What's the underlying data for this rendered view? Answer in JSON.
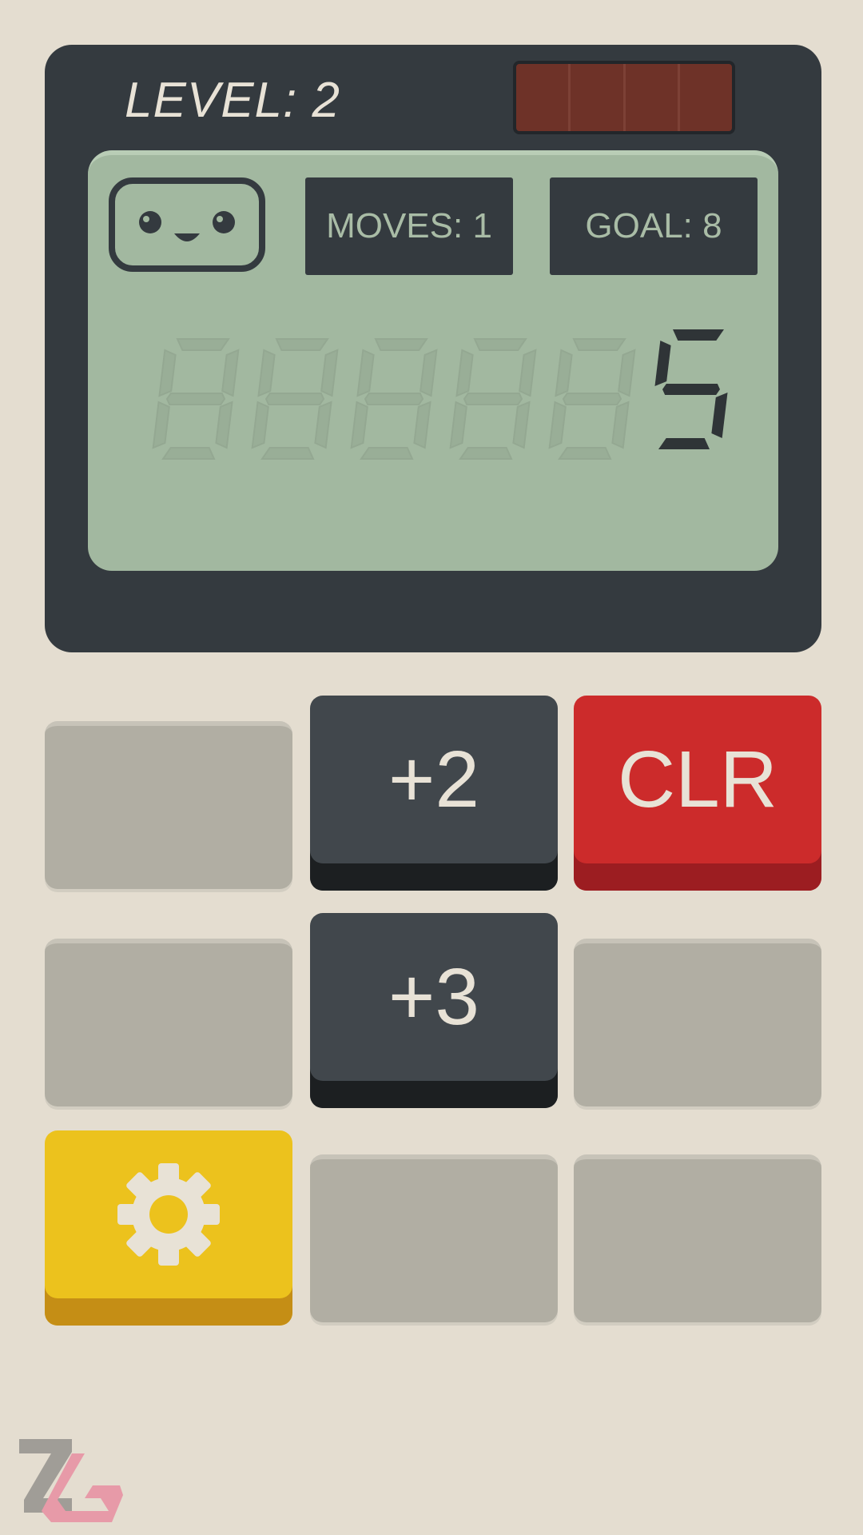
{
  "header": {
    "level_label": "LEVEL: 2"
  },
  "display": {
    "moves_label": "MOVES: 1",
    "goal_label": "GOAL: 8",
    "value": "5"
  },
  "buttons": {
    "add2_label": "+2",
    "add3_label": "+3",
    "clear_label": "CLR"
  },
  "icons": {
    "face": "robot-face-icon",
    "settings": "gear-icon",
    "watermark": "zg-logo-icon"
  },
  "colors": {
    "background": "#e4ddd0",
    "calc_body": "#343a3f",
    "lcd": "#a2b8a0",
    "clr_button": "#cc2b2b",
    "settings_button": "#ecc21d",
    "dark_button": "#41474c",
    "empty_button": "#b1aea3"
  }
}
